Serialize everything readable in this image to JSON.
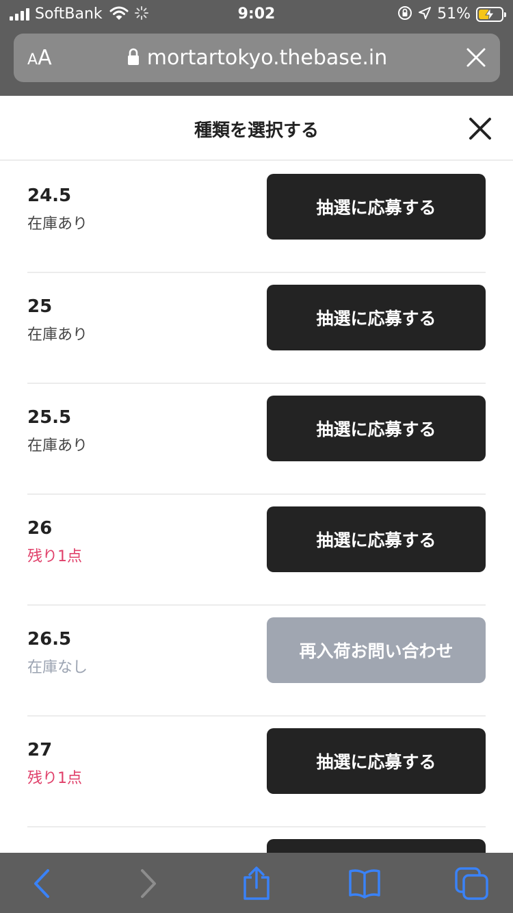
{
  "status_bar": {
    "carrier": "SoftBank",
    "time": "9:02",
    "battery_percent": "51%",
    "battery_level": 0.51,
    "icons": [
      "signal-icon",
      "wifi-icon",
      "loading-icon",
      "rotation-lock-icon",
      "location-icon",
      "battery-charging-icon"
    ]
  },
  "browser": {
    "text_size_small": "A",
    "text_size_big": "A",
    "url": "mortartokyo.thebase.in",
    "icons": [
      "lock-icon",
      "close-icon"
    ]
  },
  "sheet": {
    "title": "種類を選択する"
  },
  "variants": [
    {
      "size": "24.5",
      "stock": "在庫あり",
      "stock_color": "#444444",
      "button": "抽選に応募する",
      "button_style": "dark"
    },
    {
      "size": "25",
      "stock": "在庫あり",
      "stock_color": "#444444",
      "button": "抽選に応募する",
      "button_style": "dark"
    },
    {
      "size": "25.5",
      "stock": "在庫あり",
      "stock_color": "#444444",
      "button": "抽選に応募する",
      "button_style": "dark"
    },
    {
      "size": "26",
      "stock": "残り1点",
      "stock_color": "#e0406a",
      "button": "抽選に応募する",
      "button_style": "dark"
    },
    {
      "size": "26.5",
      "stock": "在庫なし",
      "stock_color": "#9ba3b1",
      "button": "再入荷お問い合わせ",
      "button_style": "gray"
    },
    {
      "size": "27",
      "stock": "残り1点",
      "stock_color": "#e0406a",
      "button": "抽選に応募する",
      "button_style": "dark"
    },
    {
      "size": "",
      "stock": "",
      "stock_color": "#444444",
      "button": "",
      "button_style": "dark"
    }
  ],
  "toolbar": {
    "icons": [
      "back-icon",
      "forward-icon",
      "share-icon",
      "bookmarks-icon",
      "tabs-icon"
    ],
    "accent": "#3a82f7"
  },
  "colors": {
    "chrome": "#5e5e5e",
    "address_bar": "#8a8a8a",
    "button_dark": "#232323",
    "button_gray": "#a0a6b1",
    "stock_red": "#e0406a"
  }
}
